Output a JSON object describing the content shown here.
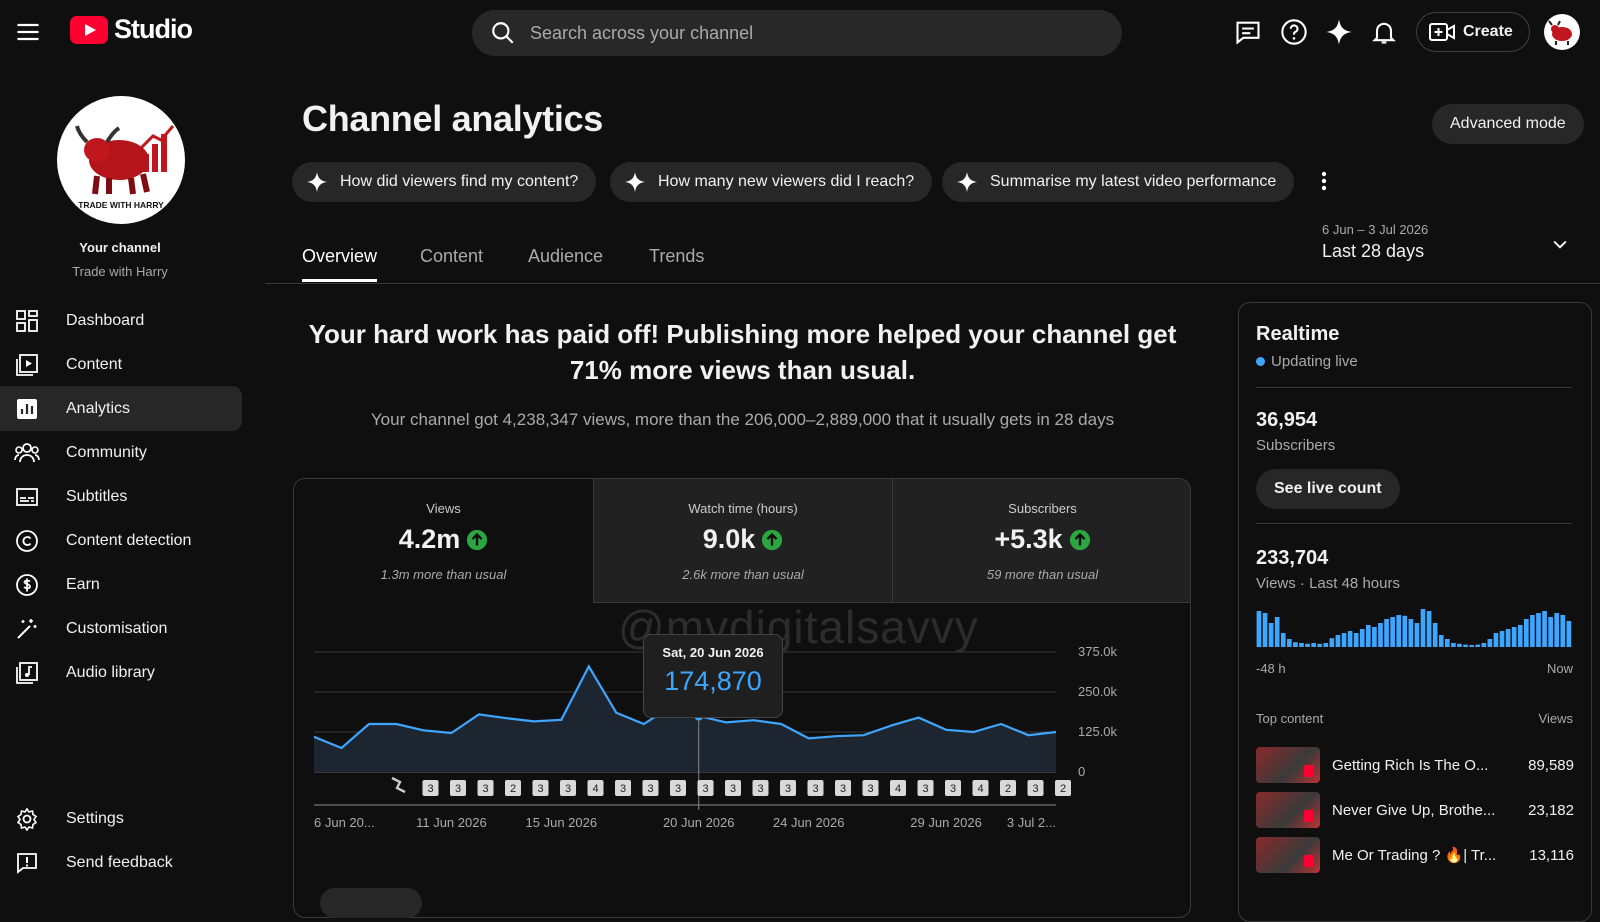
{
  "app": {
    "logo_text": "Studio"
  },
  "search": {
    "placeholder": "Search across your channel"
  },
  "header": {
    "create_label": "Create"
  },
  "channel": {
    "your_channel_label": "Your channel",
    "name": "Trade with Harry",
    "logo_text": "TRADE WITH HARRY"
  },
  "sidebar": {
    "items": [
      {
        "label": "Dashboard",
        "icon": "dashboard-icon"
      },
      {
        "label": "Content",
        "icon": "content-icon"
      },
      {
        "label": "Analytics",
        "icon": "analytics-icon",
        "active": true
      },
      {
        "label": "Community",
        "icon": "community-icon"
      },
      {
        "label": "Subtitles",
        "icon": "subtitles-icon"
      },
      {
        "label": "Content detection",
        "icon": "copyright-icon"
      },
      {
        "label": "Earn",
        "icon": "dollar-icon"
      },
      {
        "label": "Customisation",
        "icon": "magic-wand-icon"
      },
      {
        "label": "Audio library",
        "icon": "audio-library-icon"
      }
    ],
    "bottom": [
      {
        "label": "Settings",
        "icon": "gear-icon"
      },
      {
        "label": "Send feedback",
        "icon": "feedback-icon"
      }
    ]
  },
  "main": {
    "title": "Channel analytics",
    "advanced_mode_label": "Advanced mode",
    "chips": [
      "How did viewers find my content?",
      "How many new viewers did I reach?",
      "Summarise my latest video performance"
    ],
    "date_range": {
      "sub": "6 Jun – 3 Jul 2026",
      "main": "Last 28 days"
    },
    "tabs": [
      "Overview",
      "Content",
      "Audience",
      "Trends"
    ],
    "active_tab": "Overview",
    "headline": "Your hard work has paid off! Publishing more helped your channel get 71% more views than usual.",
    "subline": "Your channel got 4,238,347 views, more than the 206,000–2,889,000 that it usually gets in 28 days",
    "metrics": [
      {
        "label": "Views",
        "value": "4.2m",
        "note": "1.3m more than usual",
        "trend": "up"
      },
      {
        "label": "Watch time (hours)",
        "value": "9.0k",
        "note": "2.6k more than usual",
        "trend": "up"
      },
      {
        "label": "Subscribers",
        "value": "+5.3k",
        "note": "59 more than usual",
        "trend": "up"
      }
    ],
    "watermark": "@mydigitalsavvy",
    "tooltip": {
      "date": "Sat, 20 Jun 2026",
      "value": "174,870"
    }
  },
  "chart_data": {
    "type": "area",
    "x": [
      "6 Jun",
      "7 Jun",
      "8 Jun",
      "9 Jun",
      "10 Jun",
      "11 Jun",
      "12 Jun",
      "13 Jun",
      "14 Jun",
      "15 Jun",
      "16 Jun",
      "17 Jun",
      "18 Jun",
      "19 Jun",
      "20 Jun",
      "21 Jun",
      "22 Jun",
      "23 Jun",
      "24 Jun",
      "25 Jun",
      "26 Jun",
      "27 Jun",
      "28 Jun",
      "29 Jun",
      "30 Jun",
      "1 Jul",
      "2 Jul",
      "3 Jul"
    ],
    "series": [
      {
        "values": [
          110000,
          75000,
          150000,
          150000,
          130000,
          122000,
          180000,
          168000,
          158000,
          163000,
          330000,
          185000,
          150000,
          205000,
          174870,
          155000,
          162000,
          150000,
          105000,
          112000,
          115000,
          145000,
          170000,
          132000,
          125000,
          150000,
          115000,
          125000
        ]
      }
    ],
    "ylim": [
      0,
      375000
    ],
    "yticks": [
      "375.0k",
      "250.0k",
      "125.0k",
      "0"
    ],
    "xtick_labels": [
      "6 Jun 20...",
      "11 Jun 2026",
      "15 Jun 2026",
      "20 Jun 2026",
      "24 Jun 2026",
      "29 Jun 2026",
      "3 Jul 2..."
    ],
    "upload_markers": [
      "3",
      "3",
      "3",
      "2",
      "3",
      "3",
      "4",
      "3",
      "3",
      "3",
      "3",
      "3",
      "3",
      "3",
      "3",
      "3",
      "3",
      "4",
      "3",
      "3",
      "4",
      "2",
      "3",
      "2"
    ],
    "line_color": "#3ea6ff"
  },
  "realtime": {
    "title": "Realtime",
    "status": "Updating live",
    "subscribers_value": "36,954",
    "subscribers_label": "Subscribers",
    "live_count_label": "See live count",
    "views_value": "233,704",
    "views_label": "Views · Last 48 hours",
    "bars": [
      0.9,
      0.85,
      0.6,
      0.75,
      0.35,
      0.2,
      0.12,
      0.1,
      0.08,
      0.1,
      0.08,
      0.1,
      0.22,
      0.3,
      0.35,
      0.4,
      0.35,
      0.45,
      0.55,
      0.5,
      0.6,
      0.7,
      0.75,
      0.8,
      0.78,
      0.7,
      0.6,
      0.95,
      0.9,
      0.6,
      0.3,
      0.2,
      0.1,
      0.08,
      0.06,
      0.05,
      0.06,
      0.1,
      0.2,
      0.35,
      0.4,
      0.45,
      0.5,
      0.55,
      0.7,
      0.8,
      0.85,
      0.9,
      0.75,
      0.85,
      0.8,
      0.65
    ],
    "bar_color": "#3ea6ff",
    "axis_start": "-48 h",
    "axis_end": "Now",
    "top_content_label": "Top content",
    "views_header": "Views",
    "top_content": [
      {
        "title": "Getting Rich Is The O...",
        "views": "89,589"
      },
      {
        "title": "Never Give Up, Brothe...",
        "views": "23,182"
      },
      {
        "title": "Me Or Trading ? 🔥| Tr...",
        "views": "13,116"
      }
    ]
  }
}
